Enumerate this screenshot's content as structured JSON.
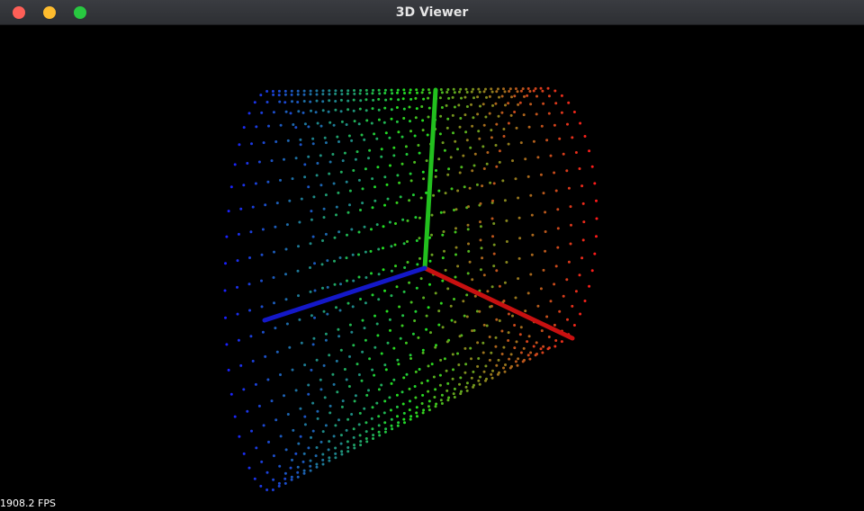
{
  "window": {
    "title": "3D Viewer"
  },
  "viewport": {
    "fps_label": "1908.2 FPS",
    "background_color": "#000000"
  },
  "axes": {
    "x_color": "#c81010",
    "y_color": "#22c01e",
    "z_color": "#1418c8"
  },
  "point_cloud": {
    "shape": "cylinder",
    "colormap": [
      "#1a20ff",
      "#22e020",
      "#ff1a1a"
    ]
  }
}
